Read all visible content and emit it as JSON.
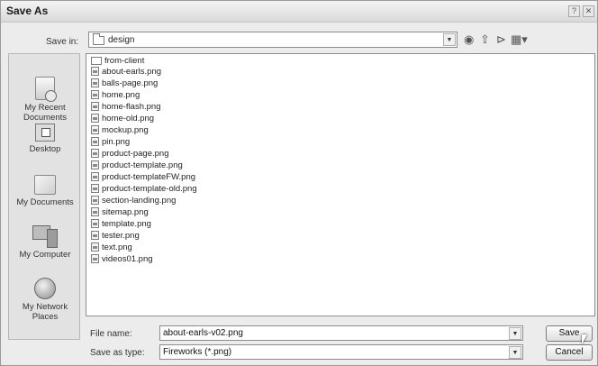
{
  "dialog": {
    "title": "Save As"
  },
  "title_buttons": {
    "help": "?",
    "close": "✕"
  },
  "save_in": {
    "label": "Save in:",
    "value": "design"
  },
  "toolbar": {
    "icons": [
      "back-icon",
      "up-folder-icon",
      "new-folder-icon",
      "views-menu-icon"
    ]
  },
  "places": [
    {
      "label": "My Recent\nDocuments",
      "icon": "recent-documents-icon"
    },
    {
      "label": "Desktop",
      "icon": "desktop-icon"
    },
    {
      "label": "My Documents",
      "icon": "my-documents-icon"
    },
    {
      "label": "My Computer",
      "icon": "my-computer-icon"
    },
    {
      "label": "My Network\nPlaces",
      "icon": "network-places-icon"
    }
  ],
  "files": [
    {
      "name": "from-client",
      "type": "folder"
    },
    {
      "name": "about-earls.png",
      "type": "file"
    },
    {
      "name": "balls-page.png",
      "type": "file"
    },
    {
      "name": "home.png",
      "type": "file"
    },
    {
      "name": "home-flash.png",
      "type": "file"
    },
    {
      "name": "home-old.png",
      "type": "file"
    },
    {
      "name": "mockup.png",
      "type": "file"
    },
    {
      "name": "pin.png",
      "type": "file"
    },
    {
      "name": "product-page.png",
      "type": "file"
    },
    {
      "name": "product-template.png",
      "type": "file"
    },
    {
      "name": "product-templateFW.png",
      "type": "file"
    },
    {
      "name": "product-template-old.png",
      "type": "file"
    },
    {
      "name": "section-landing.png",
      "type": "file"
    },
    {
      "name": "sitemap.png",
      "type": "file"
    },
    {
      "name": "template.png",
      "type": "file"
    },
    {
      "name": "tester.png",
      "type": "file"
    },
    {
      "name": "text.png",
      "type": "file"
    },
    {
      "name": "videos01.png",
      "type": "file"
    }
  ],
  "file_name": {
    "label": "File name:",
    "value": "about-earls-v02.png"
  },
  "save_as_type": {
    "label": "Save as type:",
    "value": "Fireworks (*.png)"
  },
  "buttons": {
    "save": "Save",
    "cancel": "Cancel"
  }
}
